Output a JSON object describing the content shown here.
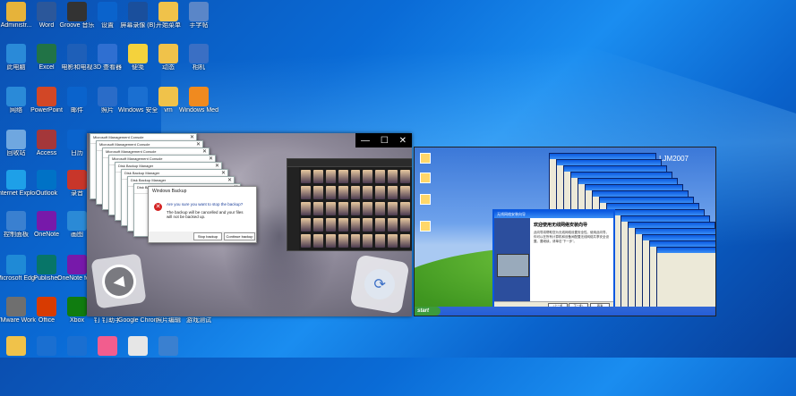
{
  "desktop": {
    "icons": [
      {
        "label": "Administr...",
        "icon": "user-folder-icon",
        "color": "#e6b33a"
      },
      {
        "label": "Word",
        "icon": "word-icon",
        "color": "#2b579a"
      },
      {
        "label": "Groove 音乐",
        "icon": "groove-icon",
        "color": "#333"
      },
      {
        "label": "设置",
        "icon": "gear-icon",
        "color": "#0a63cc"
      },
      {
        "label": "屏幕录像 (B)",
        "icon": "camera-icon",
        "color": "#1a4f9c"
      },
      {
        "label": "开始菜单",
        "icon": "folder-icon",
        "color": "#f0c24a"
      },
      {
        "label": "手字帖",
        "icon": "image-icon",
        "color": "#5a86c8"
      },
      {
        "label": "此电脑",
        "icon": "computer-icon",
        "color": "#2a8ad8"
      },
      {
        "label": "Excel",
        "icon": "excel-icon",
        "color": "#217346"
      },
      {
        "label": "电影和电视",
        "icon": "film-icon",
        "color": "#1e5fb8"
      },
      {
        "label": "3D 查看器",
        "icon": "cube-icon",
        "color": "#2f6fd1"
      },
      {
        "label": "便笺",
        "icon": "note-icon",
        "color": "#f4d23c"
      },
      {
        "label": "动态",
        "icon": "folder-icon",
        "color": "#f0c24a"
      },
      {
        "label": "相机",
        "icon": "camera-icon",
        "color": "#3a6fc4"
      },
      {
        "label": "网络",
        "icon": "network-icon",
        "color": "#2a8ad8"
      },
      {
        "label": "PowerPoint",
        "icon": "powerpoint-icon",
        "color": "#d24726"
      },
      {
        "label": "邮件",
        "icon": "mail-icon",
        "color": "#0a63cc"
      },
      {
        "label": "照片",
        "icon": "photo-icon",
        "color": "#2a6cc8"
      },
      {
        "label": "Windows 安全中心",
        "icon": "shield-icon",
        "color": "#1a6fd1"
      },
      {
        "label": "vm",
        "icon": "folder-icon",
        "color": "#f0c24a"
      },
      {
        "label": "Windows Media ...",
        "icon": "media-icon",
        "color": "#f08a1f"
      },
      {
        "label": "回收站",
        "icon": "recycle-bin-icon",
        "color": "#6fa7e0"
      },
      {
        "label": "Access",
        "icon": "access-icon",
        "color": "#a4373a"
      },
      {
        "label": "日历",
        "icon": "calendar-icon",
        "color": "#0a63cc"
      },
      {
        "label": "Internet Explorer",
        "icon": "ie-icon",
        "color": "#1ea0e8"
      },
      {
        "label": "Outlook",
        "icon": "outlook-icon",
        "color": "#0072c6"
      },
      {
        "label": "录音",
        "icon": "record-icon",
        "color": "#c8362a"
      },
      {
        "label": "控制面板",
        "icon": "control-panel-icon",
        "color": "#3a80d0"
      },
      {
        "label": "OneNote",
        "icon": "onenote-icon",
        "color": "#7719aa"
      },
      {
        "label": "画图",
        "icon": "paint-icon",
        "color": "#2b8ad6"
      },
      {
        "label": "Microsoft Edge",
        "icon": "edge-icon",
        "color": "#1f8ad6"
      },
      {
        "label": "Publisher",
        "icon": "publisher-icon",
        "color": "#077568"
      },
      {
        "label": "OneNote for Windows 10",
        "icon": "onenote-icon",
        "color": "#7719aa"
      },
      {
        "label": "VMware Workstati...",
        "icon": "vmware-icon",
        "color": "#6f6f6f"
      },
      {
        "label": "Office",
        "icon": "office-icon",
        "color": "#d83b01"
      },
      {
        "label": "Xbox",
        "icon": "xbox-icon",
        "color": "#107c10"
      },
      {
        "label": "钉 钉助手",
        "icon": "pin-icon",
        "color": "#1b1b1b"
      },
      {
        "label": "Google Chrome",
        "icon": "chrome-icon",
        "color": "#db4437"
      },
      {
        "label": "照片编辑",
        "icon": "edit-photo-icon",
        "color": "#444"
      },
      {
        "label": "游戏测试",
        "icon": "game-icon",
        "color": "#555"
      },
      {
        "label": "",
        "icon": "app-icon",
        "color": "#f0c24a"
      },
      {
        "label": "",
        "icon": "calculator-icon",
        "color": "#1a6fd1"
      },
      {
        "label": "",
        "icon": "store-icon",
        "color": "#1a6fd1"
      },
      {
        "label": "",
        "icon": "bilibili-icon",
        "color": "#f25d8e"
      },
      {
        "label": "",
        "icon": "document-icon",
        "color": "#e6e6e6"
      },
      {
        "label": "",
        "icon": "palette-icon",
        "color": "#3a80d0"
      }
    ]
  },
  "left_window": {
    "stack_titles": [
      "Microsoft Management Console",
      "Microsoft Management Console",
      "Microsoft Management Console",
      "Microsoft Management Console",
      "Disk Backup Manager",
      "Disk Backup Manager",
      "Disk Backup Manager",
      "Disk Backup Manager"
    ],
    "backup_dialog": {
      "title": "Windows Backup",
      "question": "Are you sure you want to stop the backup?",
      "message": "The backup will be cancelled and your files will not be backed up.",
      "stop_label": "Stop backup",
      "continue_label": "Continue backup"
    },
    "controls": {
      "minimize": "—",
      "maximize": "☐",
      "close": "✕"
    }
  },
  "xp_window": {
    "watermark": "LJM2007",
    "start_label": "start",
    "wizard": {
      "title": "无线网络安装向导",
      "heading": "欢迎使用无线网络安装向导",
      "text": "此向导将帮助您为无线网络设置安全性。使用此向导，你可以在所有计算机和设备间配置无线网络共享安全设置。要继续，请单击\"下一步\"。",
      "back_label": "<上一步",
      "next_label": "下一步>",
      "cancel_label": "取消"
    }
  }
}
